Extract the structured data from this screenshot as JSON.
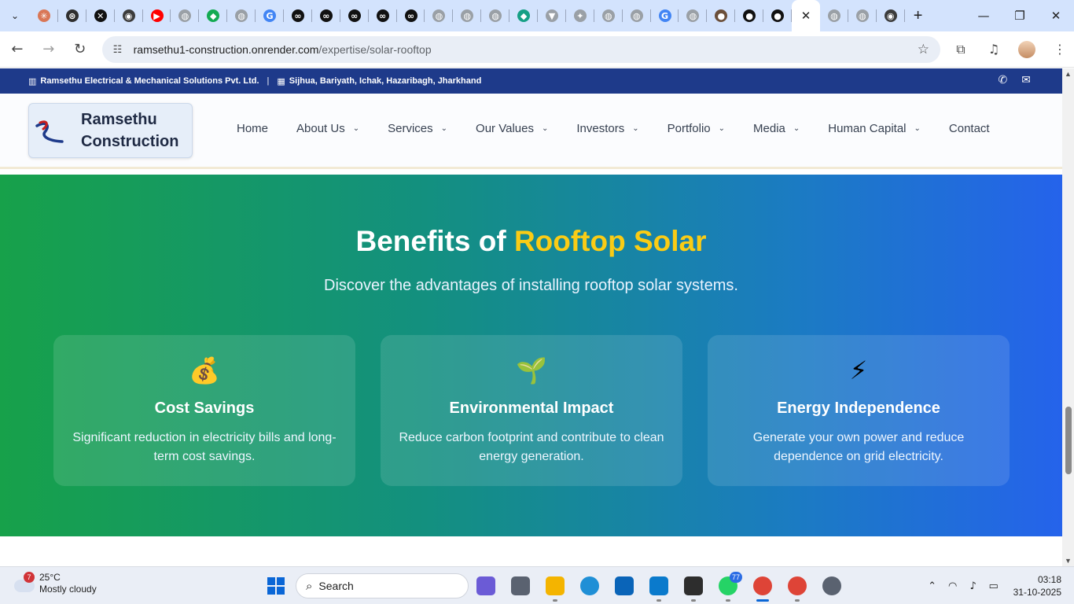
{
  "browser": {
    "tabs": [
      {
        "icon": "tab-search-icon"
      },
      {
        "icon": "claude-icon",
        "color": "#d97757"
      },
      {
        "icon": "chatgpt-icon",
        "color": "#2f2f2f"
      },
      {
        "icon": "x-icon",
        "color": "#111111"
      },
      {
        "icon": "chrome-icon",
        "color": "#3c3c3c"
      },
      {
        "icon": "youtube-icon",
        "color": "#ff0000"
      },
      {
        "icon": "globe-icon",
        "color": "#9aa0a6"
      },
      {
        "icon": "mongodb-leaf-icon",
        "color": "#13aa52"
      },
      {
        "icon": "globe-icon",
        "color": "#9aa0a6"
      },
      {
        "icon": "google-icon",
        "color": "#4285f4"
      },
      {
        "icon": "link-icon",
        "color": "#111111"
      },
      {
        "icon": "link-icon",
        "color": "#111111"
      },
      {
        "icon": "link-icon",
        "color": "#111111"
      },
      {
        "icon": "link-icon",
        "color": "#111111"
      },
      {
        "icon": "link-icon",
        "color": "#111111"
      },
      {
        "icon": "globe-icon",
        "color": "#9aa0a6"
      },
      {
        "icon": "globe-icon",
        "color": "#9aa0a6"
      },
      {
        "icon": "globe-icon",
        "color": "#9aa0a6"
      },
      {
        "icon": "diamond-icon",
        "color": "#16a085"
      },
      {
        "icon": "vercel-icon",
        "color": "#9aa0a6"
      },
      {
        "icon": "sparkle-icon",
        "color": "#9aa0a6"
      },
      {
        "icon": "globe-icon",
        "color": "#9aa0a6"
      },
      {
        "icon": "globe-icon",
        "color": "#9aa0a6"
      },
      {
        "icon": "google-icon",
        "color": "#4285f4"
      },
      {
        "icon": "globe-icon",
        "color": "#9aa0a6"
      },
      {
        "icon": "person-icon",
        "color": "#6b4f3a"
      },
      {
        "icon": "github-icon",
        "color": "#111111"
      },
      {
        "icon": "github-icon",
        "color": "#111111"
      }
    ],
    "active_tab_close": "✕",
    "tabs_after": [
      {
        "icon": "globe-icon",
        "color": "#9aa0a6"
      },
      {
        "icon": "globe-icon",
        "color": "#9aa0a6"
      },
      {
        "icon": "chrome-icon",
        "color": "#3c3c3c"
      }
    ],
    "new_tab": "+",
    "window": {
      "minimize": "—",
      "maximize": "❐",
      "close": "✕"
    },
    "address": {
      "host": "ramsethu1-construction.onrender.com",
      "path": "/expertise/solar-rooftop"
    }
  },
  "site": {
    "topbar": {
      "company": "Ramsethu Electrical & Mechanical Solutions Pvt. Ltd.",
      "divider": "|",
      "location": "Sijhua, Bariyath, Ichak, Hazaribagh, Jharkhand"
    },
    "brand": {
      "line1": "Ramsethu",
      "line2": "Construction"
    },
    "menu": [
      {
        "label": "Home",
        "has_dropdown": false
      },
      {
        "label": "About Us",
        "has_dropdown": true
      },
      {
        "label": "Services",
        "has_dropdown": true
      },
      {
        "label": "Our Values",
        "has_dropdown": true
      },
      {
        "label": "Investors",
        "has_dropdown": true
      },
      {
        "label": "Portfolio",
        "has_dropdown": true
      },
      {
        "label": "Media",
        "has_dropdown": true
      },
      {
        "label": "Human Capital",
        "has_dropdown": true
      },
      {
        "label": "Contact",
        "has_dropdown": false
      }
    ],
    "benefits": {
      "title_part1": "Benefits of ",
      "title_highlight": "Rooftop Solar",
      "subtitle": "Discover the advantages of installing rooftop solar systems.",
      "cards": [
        {
          "icon": "💰",
          "title": "Cost Savings",
          "desc": "Significant reduction in electricity bills and long-term cost savings."
        },
        {
          "icon": "🌱",
          "title": "Environmental Impact",
          "desc": "Reduce carbon footprint and contribute to clean energy generation."
        },
        {
          "icon": "⚡",
          "title": "Energy Independence",
          "desc": "Generate your own power and reduce dependence on grid electricity."
        }
      ]
    },
    "colors": {
      "topbar": "#1e3a8a",
      "highlight": "#facc15",
      "gradient_start": "#17a14a",
      "gradient_end": "#2563eb"
    }
  },
  "taskbar": {
    "weather": {
      "badge": "7",
      "temp": "25°C",
      "condition": "Mostly cloudy"
    },
    "search_placeholder": "Search",
    "apps": [
      {
        "name": "copilot-app-icon",
        "color": "#6b5bd6",
        "running": false
      },
      {
        "name": "task-view-icon",
        "color": "#5a6270",
        "running": false
      },
      {
        "name": "file-explorer-icon",
        "color": "#f4b400",
        "running": true
      },
      {
        "name": "edge-icon",
        "color": "#1f8fd6",
        "running": false
      },
      {
        "name": "outlook-icon",
        "color": "#0a64b8",
        "running": false
      },
      {
        "name": "vscode-icon",
        "color": "#0a7acc",
        "running": true
      },
      {
        "name": "terminal-icon",
        "color": "#2d2d2d",
        "running": true
      },
      {
        "name": "whatsapp-icon",
        "color": "#25d366",
        "running": true,
        "count": "77"
      },
      {
        "name": "chrome-icon",
        "color": "#de4437",
        "running": true,
        "active": true
      },
      {
        "name": "chrome-profile-icon",
        "color": "#de4437",
        "running": true
      },
      {
        "name": "settings-icon",
        "color": "#5a6270",
        "running": false
      }
    ],
    "clock": {
      "time": "03:18",
      "date": "31-10-2025"
    }
  }
}
